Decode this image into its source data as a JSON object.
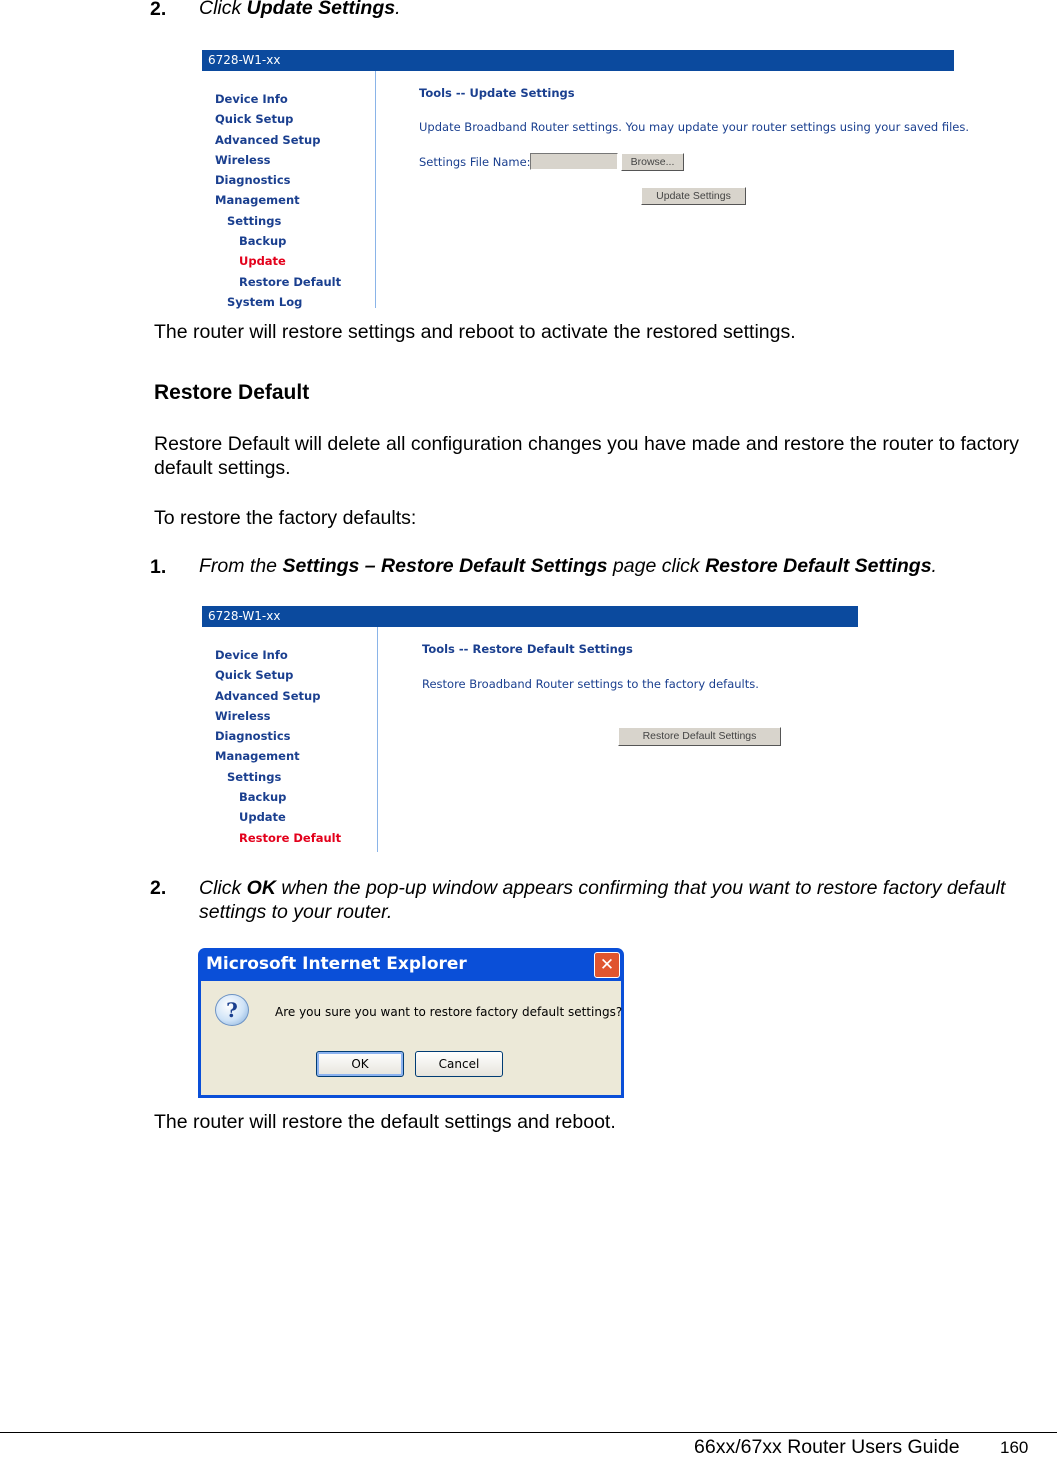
{
  "step_update": {
    "number": "2.",
    "prefix": "Click ",
    "bold": "Update Settings",
    "suffix": "."
  },
  "screenshot_update": {
    "window_title": "6728-W1-xx",
    "nav": [
      {
        "label": "Device Info",
        "level": 0,
        "active": false
      },
      {
        "label": "Quick Setup",
        "level": 0,
        "active": false
      },
      {
        "label": "Advanced Setup",
        "level": 0,
        "active": false
      },
      {
        "label": "Wireless",
        "level": 0,
        "active": false
      },
      {
        "label": "Diagnostics",
        "level": 0,
        "active": false
      },
      {
        "label": "Management",
        "level": 0,
        "active": false
      },
      {
        "label": "Settings",
        "level": 1,
        "active": false
      },
      {
        "label": "Backup",
        "level": 2,
        "active": false
      },
      {
        "label": "Update",
        "level": 2,
        "active": true
      },
      {
        "label": "Restore Default",
        "level": 2,
        "active": false
      },
      {
        "label": "System Log",
        "level": 1,
        "active": false
      }
    ],
    "page_title": "Tools -- Update Settings",
    "description": "Update Broadband Router settings. You may update your router settings using your saved files.",
    "file_label": "Settings File Name:",
    "file_value": "",
    "browse_label": "Browse...",
    "submit_label": "Update Settings"
  },
  "para_restore_reboot": "The router will restore settings and reboot to activate the restored settings.",
  "heading_restore_default": "Restore Default",
  "para_restore_default": "Restore Default will delete all configuration changes you have made and restore the router to factory default settings.",
  "para_to_restore": "To restore the factory defaults:",
  "step_restore1": {
    "number": "1.",
    "prefix": "From the ",
    "bold1": "Settings – Restore Default Settings",
    "middle": " page click ",
    "bold2": "Restore Default Settings",
    "suffix": "."
  },
  "screenshot_restore": {
    "window_title": "6728-W1-xx",
    "nav": [
      {
        "label": "Device Info",
        "level": 0,
        "active": false
      },
      {
        "label": "Quick Setup",
        "level": 0,
        "active": false
      },
      {
        "label": "Advanced Setup",
        "level": 0,
        "active": false
      },
      {
        "label": "Wireless",
        "level": 0,
        "active": false
      },
      {
        "label": "Diagnostics",
        "level": 0,
        "active": false
      },
      {
        "label": "Management",
        "level": 0,
        "active": false
      },
      {
        "label": "Settings",
        "level": 1,
        "active": false
      },
      {
        "label": "Backup",
        "level": 2,
        "active": false
      },
      {
        "label": "Update",
        "level": 2,
        "active": false
      },
      {
        "label": "Restore Default",
        "level": 2,
        "active": true
      }
    ],
    "page_title": "Tools -- Restore Default Settings",
    "description": "Restore Broadband Router settings to the factory defaults.",
    "submit_label": "Restore Default Settings"
  },
  "step_restore2": {
    "number": "2.",
    "prefix": "Click ",
    "bold": "OK",
    "suffix": " when the pop-up window appears confirming that you want to restore factory default settings to your router."
  },
  "dialog": {
    "title": "Microsoft Internet Explorer",
    "close_glyph": "✕",
    "icon_glyph": "?",
    "message": "Are you sure you want to restore factory default settings?",
    "ok_label": "OK",
    "cancel_label": "Cancel"
  },
  "para_final": "The router will restore the default settings and reboot.",
  "footer": {
    "guide_title": "66xx/67xx Router Users Guide",
    "page_number": "160"
  }
}
